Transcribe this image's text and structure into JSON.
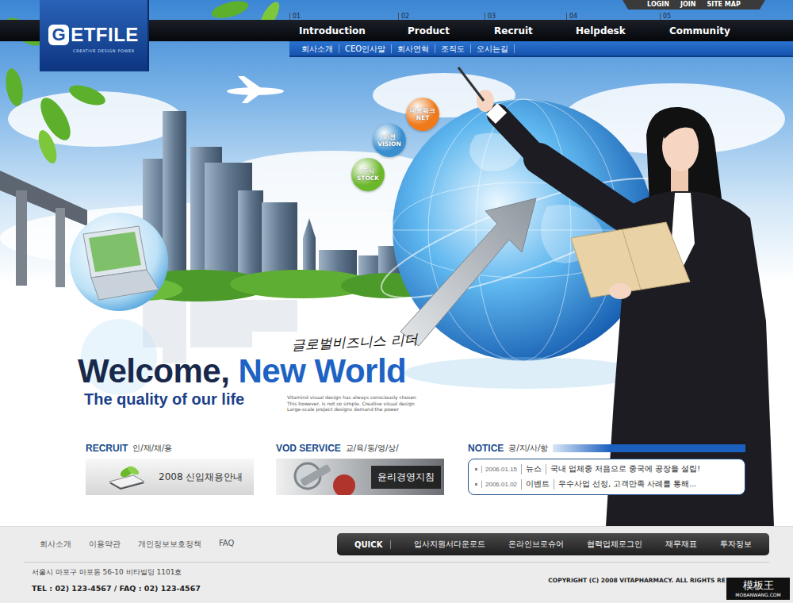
{
  "logo": {
    "mark": "G",
    "name": "ETFILE",
    "tagline": "CREATIVE DESIGN POWER"
  },
  "utility_links": [
    "LOGIN",
    "JOIN",
    "SITE MAP"
  ],
  "nav": [
    {
      "number": "01",
      "label": "Introduction"
    },
    {
      "number": "02",
      "label": "Product"
    },
    {
      "number": "03",
      "label": "Recruit"
    },
    {
      "number": "04",
      "label": "Helpdesk"
    },
    {
      "number": "05",
      "label": "Community"
    }
  ],
  "subnav": [
    "회사소개",
    "CEO인사말",
    "회사연혁",
    "조직도",
    "오시는길"
  ],
  "hero": {
    "bubbles": [
      {
        "ko": "네트워크",
        "en": "NET",
        "color": "#f07a1a"
      },
      {
        "ko": "비젼",
        "en": "VISION",
        "color": "#3a8fd0"
      },
      {
        "ko": "주식",
        "en": "STOCK",
        "color": "#6cb82c"
      }
    ],
    "script": "글로벌비즈니스 리더",
    "welcome": "Welcome,",
    "highlight": "New World",
    "subtitle": "The quality of our life",
    "blurb": [
      "Vitamind visual design has always consciously chosen",
      "This however, is not so simple. Creative visual design",
      "Large-scale project designs demand the power"
    ]
  },
  "recruit": {
    "title": "RECRUIT",
    "subtitle": "인/재/채/용",
    "banner": "2008 신입채용안내"
  },
  "vod": {
    "title": "VOD SERVICE",
    "subtitle": "교/육/동/영/상/",
    "banner": "윤리경영지침"
  },
  "notice": {
    "title": "NOTICE",
    "subtitle": "공/지/사/항",
    "items": [
      {
        "date": "2006.01.15",
        "category": "뉴스",
        "title": "국내 업체중 처음으로 중국에 공장을 설립!"
      },
      {
        "date": "2006.01.02",
        "category": "이벤트",
        "title": "우수사업 선정, 고객만족 사례를 통해..."
      }
    ]
  },
  "footer": {
    "links": [
      "회사소개",
      "이용약관",
      "개인정보보호정책",
      "FAQ"
    ],
    "quick_label": "QUICK",
    "quick_links": [
      "입사지원서다운로드",
      "온라인브로슈어",
      "협력업체로그인",
      "재무재표",
      "투자정보"
    ],
    "address": "서울시 마포구 마포동 56-10 비타빌딩 1101호",
    "contact": "TEL : 02) 123-4567  /  FAQ : 02) 123-4567",
    "copyright": "COPYRIGHT (C) 2008 VITAPHARMACY. ALL RIGHTS RE"
  },
  "watermark": {
    "title": "模板王",
    "url": "MOBANWANG.COM"
  }
}
